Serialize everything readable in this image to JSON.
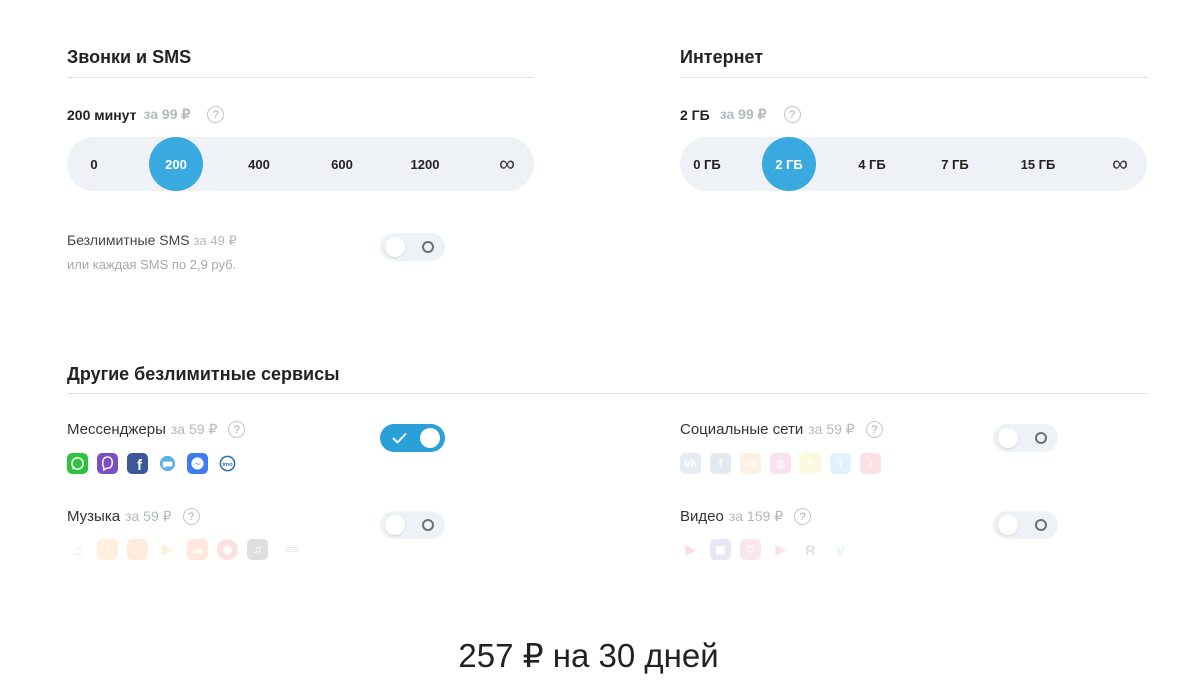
{
  "calls": {
    "title": "Звонки и SMS",
    "amount": "200 минут",
    "price": "за 99 ₽",
    "help": "?",
    "options": [
      "0",
      "200",
      "400",
      "600",
      "1200",
      "∞"
    ],
    "selected": "200"
  },
  "sms": {
    "label": "Безлимитные SMS",
    "price": "за 49 ₽",
    "note": "или каждая SMS по 2,9 руб.",
    "enabled": false
  },
  "internet": {
    "title": "Интернет",
    "amount": "2 ГБ",
    "price": "за 99 ₽",
    "help": "?",
    "options": [
      "0 ГБ",
      "2 ГБ",
      "4 ГБ",
      "7 ГБ",
      "15 ГБ",
      "∞"
    ],
    "selected": "2 ГБ"
  },
  "services": {
    "title": "Другие безлимитные сервисы",
    "help": "?",
    "messengers": {
      "label": "Мессенджеры",
      "price": "за 59 ₽",
      "enabled": true,
      "icons": [
        "whatsapp-icon",
        "viber-icon",
        "facebook-icon",
        "tamtam-icon",
        "messenger-icon",
        "imo-icon"
      ]
    },
    "social": {
      "label": "Социальные сети",
      "price": "за 59 ₽",
      "enabled": false,
      "icons": [
        "vk-icon",
        "facebook-icon",
        "odnoklassniki-icon",
        "instagram-icon",
        "snapchat-icon",
        "twitter-icon",
        "tiktok-icon"
      ]
    },
    "music": {
      "label": "Музыка",
      "price": "за 59 ₽",
      "enabled": false,
      "icons": [
        "music-note-icon",
        "music-service-icon",
        "music-home-icon",
        "play-music-icon",
        "soundcloud-icon",
        "record-icon",
        "apple-music-icon",
        "deezer-icon"
      ]
    },
    "video": {
      "label": "Видео",
      "price": "за 159 ₽",
      "enabled": false,
      "icons": [
        "youtube-icon",
        "twitch-icon",
        "likee-icon",
        "rutube-icon",
        "r-icon",
        "vimeo-icon"
      ]
    }
  },
  "total": {
    "text": "257 ₽ на 30 дней"
  },
  "colors": {
    "accent": "#39a9df",
    "toggle_on": "#2b9fd8",
    "track": "#eef1f5",
    "muted": "#b4b8bd"
  }
}
